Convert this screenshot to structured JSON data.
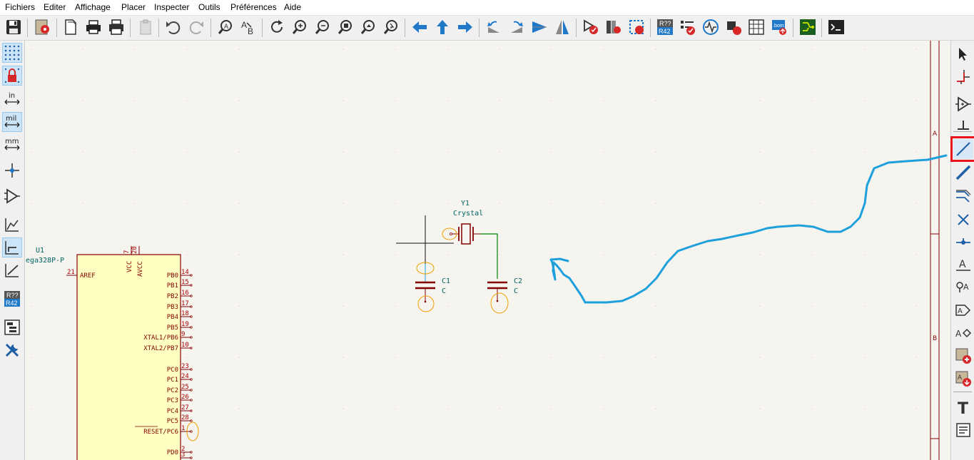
{
  "menu": [
    "Fichiers",
    "Editer",
    "Affichage",
    "Placer",
    "Inspecter",
    "Outils",
    "Préférences",
    "Aide"
  ],
  "toolbar_icons": [
    "save-icon",
    "schematic-setup-icon",
    "new-sheet-icon",
    "print-icon",
    "plot-icon",
    "paste-icon",
    "undo-icon",
    "redo-icon",
    "find-icon",
    "find-replace-icon",
    "refresh-icon",
    "zoom-in-icon",
    "zoom-out-icon",
    "zoom-fit-icon",
    "zoom-objects-icon",
    "zoom-selection-icon",
    "navigate-back-icon",
    "navigate-up-icon",
    "navigate-forward-icon",
    "rotate-ccw-icon",
    "rotate-cw-icon",
    "mirror-horizontal-icon",
    "mirror-vertical-icon",
    "symbol-editor-icon",
    "symbol-browser-icon",
    "footprint-assign-icon",
    "annotate-icon",
    "erc-icon",
    "simulator-icon",
    "assign-footprints-icon",
    "bom-icon",
    "generate-bom-icon",
    "pcb-editor-icon",
    "scripting-console-icon"
  ],
  "left_toolbar": {
    "unit_in": "in",
    "unit_mil": "mil",
    "unit_mm": "mm",
    "annotate_top": "R??",
    "annotate_bottom": "R42"
  },
  "toolbar": {
    "annotate_top": "R??",
    "annotate_bottom": "R42",
    "bom_label": ".bom"
  },
  "border": {
    "zone_a": "A",
    "zone_b": "B"
  },
  "schematic": {
    "u1": {
      "ref": "U1",
      "value": "ega328P-P",
      "top_pins": [
        {
          "name": "VCC",
          "number": "7"
        },
        {
          "name": "AVCC",
          "number": "20"
        }
      ],
      "left_pins": [
        {
          "name": "AREF",
          "number": "21"
        }
      ],
      "right_pins": [
        {
          "name": "PB0",
          "number": "14"
        },
        {
          "name": "PB1",
          "number": "15"
        },
        {
          "name": "PB2",
          "number": "16"
        },
        {
          "name": "PB3",
          "number": "17"
        },
        {
          "name": "PB4",
          "number": "18"
        },
        {
          "name": "PB5",
          "number": "19"
        },
        {
          "name": "XTAL1/PB6",
          "number": "9"
        },
        {
          "name": "XTAL2/PB7",
          "number": "10"
        },
        {
          "name": "PC0",
          "number": "23"
        },
        {
          "name": "PC1",
          "number": "24"
        },
        {
          "name": "PC2",
          "number": "25"
        },
        {
          "name": "PC3",
          "number": "26"
        },
        {
          "name": "PC4",
          "number": "27"
        },
        {
          "name": "PC5",
          "number": "28"
        },
        {
          "name": "RESET/PC6",
          "number": "1"
        },
        {
          "name": "PD0",
          "number": "2"
        },
        {
          "name": "",
          "number": "3"
        }
      ]
    },
    "y1": {
      "ref": "Y1",
      "value": "Crystal"
    },
    "c1": {
      "ref": "C1",
      "value": "C"
    },
    "c2": {
      "ref": "C2",
      "value": "C"
    }
  },
  "right_toolbar": {
    "text_tool": "T",
    "label_tool": "A",
    "highlighted_tool": "draw-wire-tool"
  },
  "colors": {
    "canvas_bg": "#f5f4ef",
    "component_body": "#ffffc2",
    "component_outline": "#840000",
    "pin_number": "#a90000",
    "ref_text": "#006464",
    "wire": "#008400",
    "annotation_blue": "#1da0dc",
    "highlight_red": "#e8131b",
    "unconnected_orange": "#f0a000"
  }
}
